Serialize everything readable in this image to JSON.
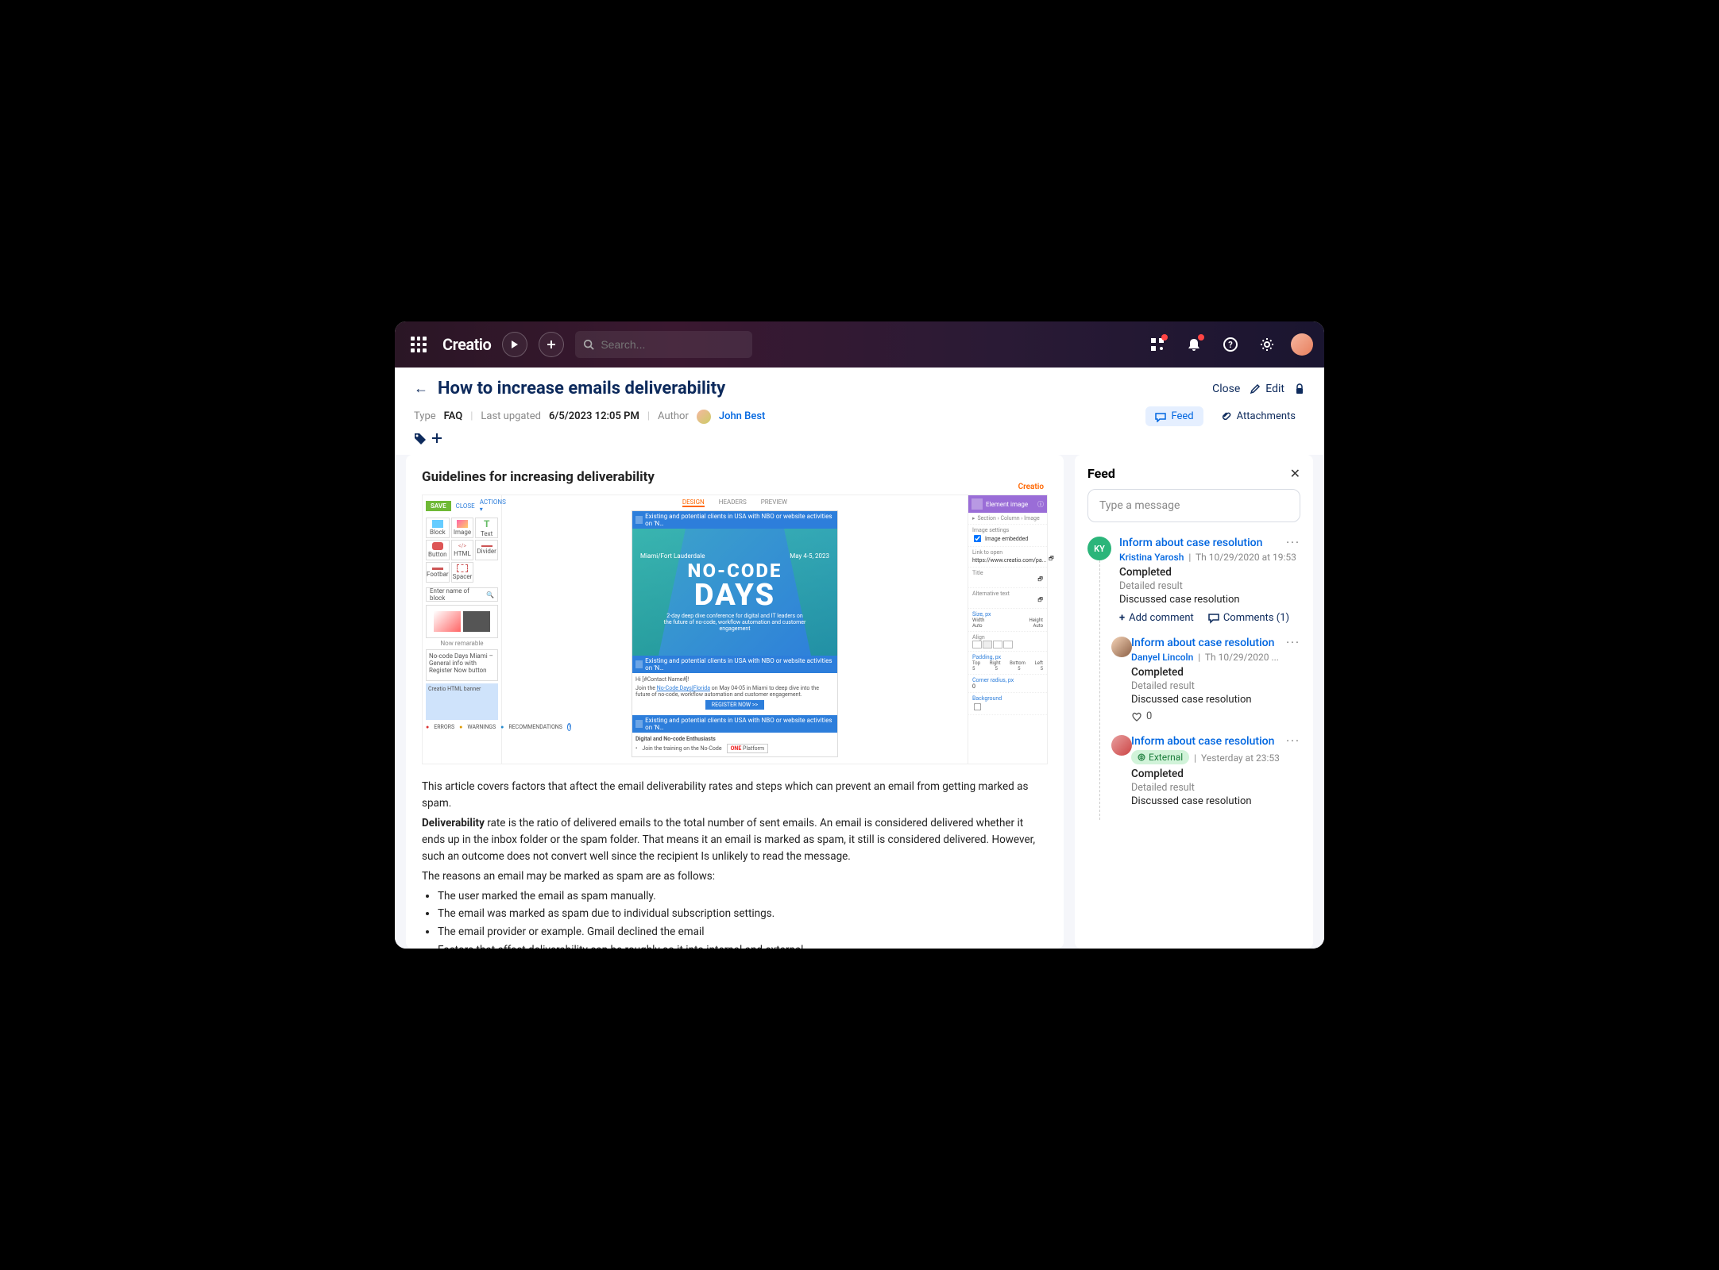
{
  "topbar": {
    "logo": "Creatio",
    "search_placeholder": "Search..."
  },
  "header": {
    "title": "How to increase emails deliverability",
    "close": "Close",
    "edit": "Edit"
  },
  "meta": {
    "type_label": "Type",
    "type_value": "FAQ",
    "updated_label": "Last upgated",
    "updated_value": "6/5/2023 12:05 PM",
    "author_label": "Author",
    "author_value": "John Best",
    "feed_tab": "Feed",
    "attachments_tab": "Attachments"
  },
  "content": {
    "section_title": "Guidelines for increasing deliverability",
    "intro": "This article covers factors that aftect the email deliverability rates and steps which can prevent an email from getting marked as spam.",
    "deliverability_label": "Deliverability",
    "deliverability_body": " rate is the ratio of delivered emails to the total number of sent emails. An email is considered delivered whether it ends up in the inbox folder or the spam folder. That means it an email is marked as spam, it still is considered delivered. However, such an outcome does not convert well since the recipient Is unlikely to read the message.",
    "reasons_lead": "The reasons an email may be marked as spam are as follows:",
    "bullets": [
      "The user marked the email as spam manually.",
      "The email was marked as spam due to individual subscription settings.",
      "The email provider or example. Gmail declined the email",
      "Factors that affect deliverability can be roughly so it into internal and external."
    ]
  },
  "designer": {
    "save": "SAVE",
    "close": "CLOSE",
    "actions": "ACTIONS",
    "tabs": {
      "design": "DESIGN",
      "headers": "HEADERS",
      "preview": "PREVIEW"
    },
    "brand": "Creatio",
    "tools": [
      "Block",
      "Image",
      "Text",
      "Button",
      "HTML",
      "Divider",
      "Footbar",
      "Spacer"
    ],
    "search_ph": "Enter name of block",
    "thumb_cap": "Now remarable",
    "strip": "No-code Days Miami – General info with Register Now button",
    "blue_strip": "Creatio HTML banner",
    "footer": {
      "errors": "ERRORS",
      "warnings": "WARNINGS",
      "rec": "RECOMMENDATIONS"
    },
    "chip": "Existing and potential clients in USA with NBO or website activities on 'N…",
    "banner": {
      "loc": "Miami/Fort Lauderdale",
      "dates": "May 4-5, 2023",
      "l1": "NO-CODE",
      "l2": "DAYS",
      "sub": "2-day deep dive conference for digital and IT leaders on the future of no-code, workflow automation and customer engagement"
    },
    "body": {
      "greet": "Hi [#Contact Name#]!",
      "line": "Join the No-Code Days|Florida on May 04-05 in Miami to deep dive into the future of no-code, workflow automation and customer engagement.",
      "link": "No-Code Days|Florida",
      "register": "REGISTER NOW >>",
      "section": "Digital and No-code Enthusiasts",
      "sub": "Join the training on the No-Code",
      "one": "ONE",
      "platform": " Platform"
    },
    "right": {
      "el": "Element image",
      "crumb": "Section › Column › Image",
      "settings": "Image settings",
      "embedded": "Image embedded",
      "link": "Link to open",
      "url": "https://www.creatio.com/pa...",
      "title": "Title",
      "alt": "Alternative text",
      "size": "Size, px",
      "width": "Width",
      "height": "Height",
      "auto": "Auto",
      "align": "Align",
      "padding": "Padding, px",
      "top": "Top",
      "right_l": "Right",
      "bottom": "Bottom",
      "left_l": "Left",
      "padv": "5",
      "corner": "Corner radius, px",
      "cornerv": "0",
      "bg": "Background"
    }
  },
  "feed": {
    "title": "Feed",
    "placeholder": "Type a message",
    "add_comment": "Add comment",
    "comments": "Comments (1)",
    "items": [
      {
        "avatar": "KY",
        "title": "Inform about case resolution",
        "author": "Kristina Yarosh",
        "ts": "Th 10/29/2020 at 19:53",
        "status": "Completed",
        "detail": "Detailed result",
        "desc": "Discussed case resolution"
      },
      {
        "title": "Inform about case resolution",
        "author": "Danyel Lincoln",
        "ts": "Th 10/29/2020 ...",
        "status": "Completed",
        "detail": "Detailed result",
        "desc": "Discussed case resolution",
        "likes": "0"
      },
      {
        "title": "Inform about case resolution",
        "external": "External",
        "ts": "Yesterday at 23:53",
        "status": "Completed",
        "detail": "Detailed result",
        "desc": "Discussed case resolution"
      }
    ]
  }
}
